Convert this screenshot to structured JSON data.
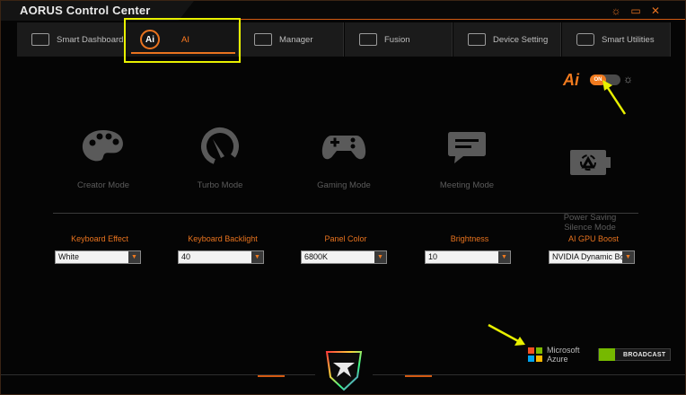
{
  "window": {
    "title": "AORUS Control Center",
    "controls": [
      "settings-icon",
      "restore-icon",
      "close-icon"
    ],
    "accent_color": "#e9731f"
  },
  "tabs": [
    {
      "label": "Smart Dashboard",
      "icon": "monitor-icon",
      "active": false
    },
    {
      "label": "AI",
      "icon": "ai-icon",
      "active": true
    },
    {
      "label": "Manager",
      "icon": "keyboard-grid-icon",
      "active": false
    },
    {
      "label": "Fusion",
      "icon": "keyboard-icon",
      "active": false
    },
    {
      "label": "Device Setting",
      "icon": "laptop-icon",
      "active": false
    },
    {
      "label": "Smart Utilities",
      "icon": "utility-icon",
      "active": false
    }
  ],
  "ai_toggle": {
    "logo": "Ai",
    "state_label": "ON"
  },
  "modes": [
    {
      "label": "Creator Mode",
      "icon": "palette-icon"
    },
    {
      "label": "Turbo Mode",
      "icon": "speedometer-icon"
    },
    {
      "label": "Gaming Mode",
      "icon": "gamepad-icon"
    },
    {
      "label": "Meeting Mode",
      "icon": "chat-bubble-icon"
    },
    {
      "label": "Power Saving\nSilence Mode",
      "icon": "battery-recycle-icon"
    }
  ],
  "settings": [
    {
      "label": "Keyboard Effect",
      "value": "White"
    },
    {
      "label": "Keyboard Backlight",
      "value": "40"
    },
    {
      "label": "Panel Color",
      "value": "6800K"
    },
    {
      "label": "Brightness",
      "value": "10"
    },
    {
      "label": "AI GPU Boost",
      "value": "NVIDIA Dynamic Boost"
    }
  ],
  "partners": {
    "azure_line1": "Microsoft",
    "azure_line2": "Azure",
    "nvidia_label": "BROADCAST"
  }
}
